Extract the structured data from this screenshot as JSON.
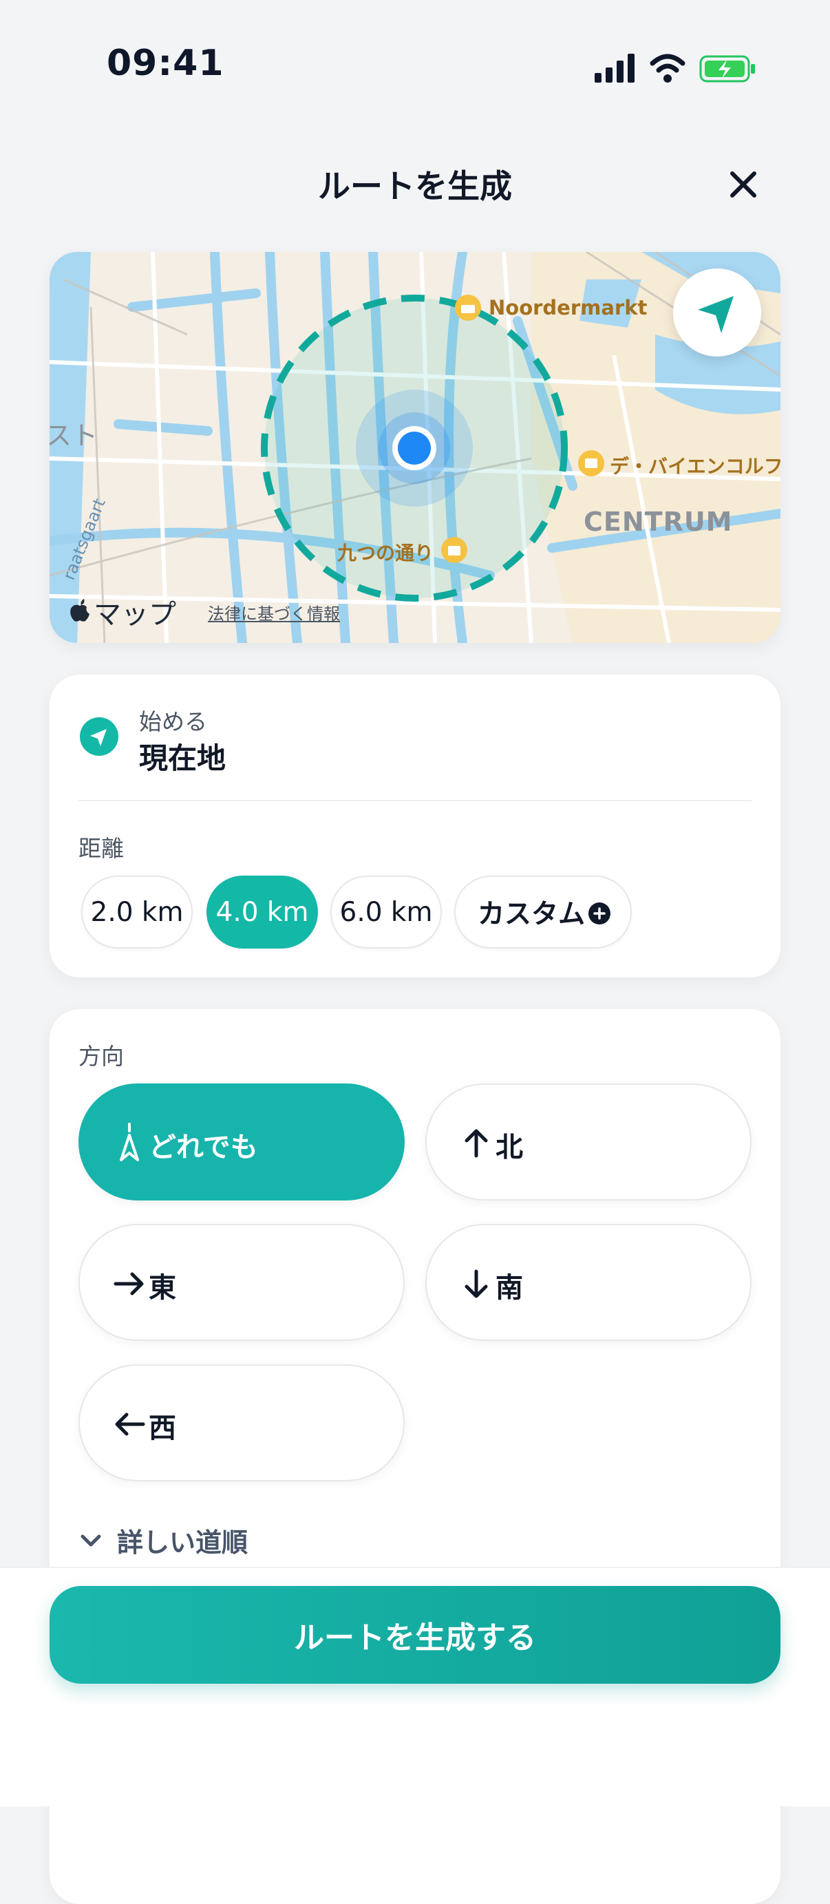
{
  "status_bar": {
    "time": "09:41"
  },
  "header": {
    "title": "ルートを生成"
  },
  "map": {
    "poi_noordermarkt": "Noordermarkt",
    "poi_debijenkorf": "デ・バイエンコルフ",
    "poi_nine_streets": "九つの通り",
    "district": "CENTRUM",
    "partial_left": "スト",
    "partial_street": "raatsgaart",
    "attribution_brand": "マップ",
    "legal": "法律に基づく情報"
  },
  "start": {
    "label": "始める",
    "value": "現在地"
  },
  "distance": {
    "label": "距離",
    "options": [
      "2.0 km",
      "4.0 km",
      "6.0 km",
      "カスタム"
    ],
    "selected": "4.0 km"
  },
  "direction": {
    "label": "方向",
    "options": [
      "どれでも",
      "北",
      "東",
      "南",
      "西"
    ],
    "selected": "どれでも"
  },
  "details_toggle": "詳しい道順",
  "cta": "ルートを生成する",
  "colors": {
    "accent": "#14b8a6",
    "user_dot": "#1e88f5"
  }
}
